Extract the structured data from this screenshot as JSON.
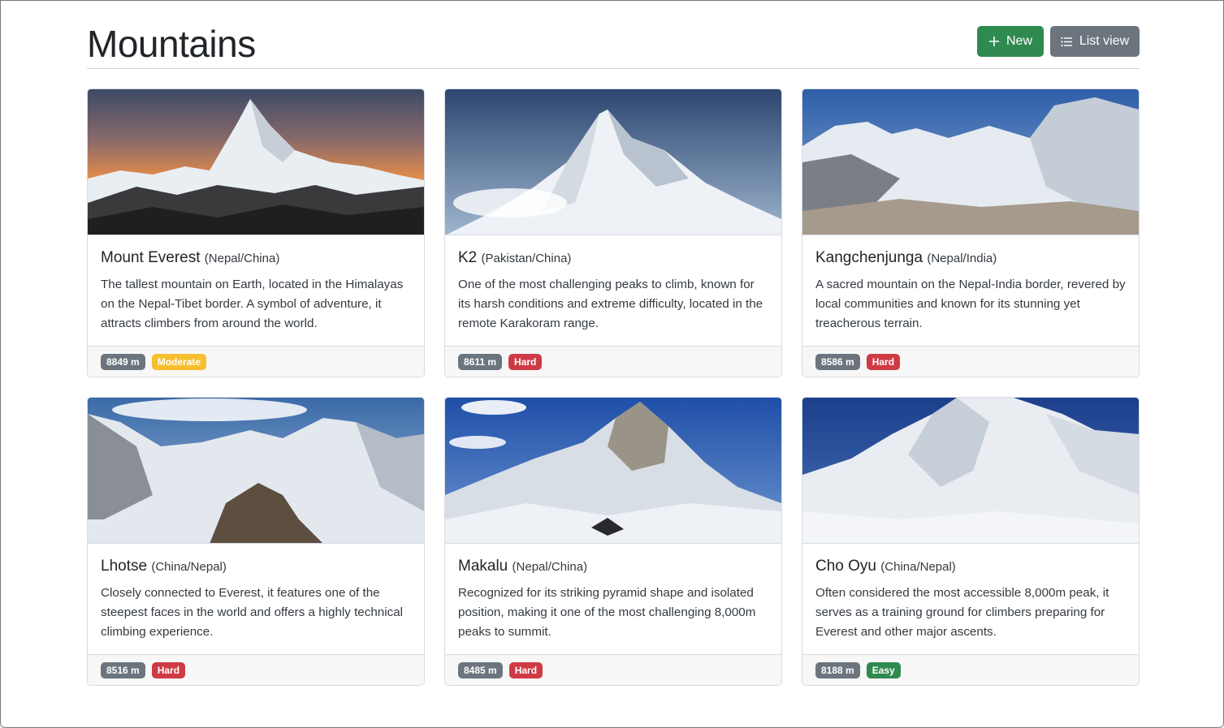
{
  "header": {
    "title": "Mountains",
    "new_label": "New",
    "list_view_label": "List view"
  },
  "colors": {
    "new_button": "#2f8a4f",
    "list_view_button": "#6c757d",
    "badge_height": "#6c757d",
    "badge_moderate": "#f7bf2e",
    "badge_hard": "#cf3b45",
    "badge_easy": "#2f8a4f"
  },
  "mountains": [
    {
      "name": "Mount Everest",
      "country": "(Nepal/China)",
      "description": "The tallest mountain on Earth, located in the Himalayas on the Nepal-Tibet border. A symbol of adventure, it attracts climbers from around the world.",
      "height": "8849 m",
      "difficulty": "Moderate"
    },
    {
      "name": "K2",
      "country": "(Pakistan/China)",
      "description": "One of the most challenging peaks to climb, known for its harsh conditions and extreme difficulty, located in the remote Karakoram range.",
      "height": "8611 m",
      "difficulty": "Hard"
    },
    {
      "name": "Kangchenjunga",
      "country": "(Nepal/India)",
      "description": "A sacred mountain on the Nepal-India border, revered by local communities and known for its stunning yet treacherous terrain.",
      "height": "8586 m",
      "difficulty": "Hard"
    },
    {
      "name": "Lhotse",
      "country": "(China/Nepal)",
      "description": "Closely connected to Everest, it features one of the steepest faces in the world and offers a highly technical climbing experience.",
      "height": "8516 m",
      "difficulty": "Hard"
    },
    {
      "name": "Makalu",
      "country": "(Nepal/China)",
      "description": "Recognized for its striking pyramid shape and isolated position, making it one of the most challenging 8,000m peaks to summit.",
      "height": "8485 m",
      "difficulty": "Hard"
    },
    {
      "name": "Cho Oyu",
      "country": "(China/Nepal)",
      "description": "Often considered the most accessible 8,000m peak, it serves as a training ground for climbers preparing for Everest and other major ascents.",
      "height": "8188 m",
      "difficulty": "Easy"
    }
  ]
}
